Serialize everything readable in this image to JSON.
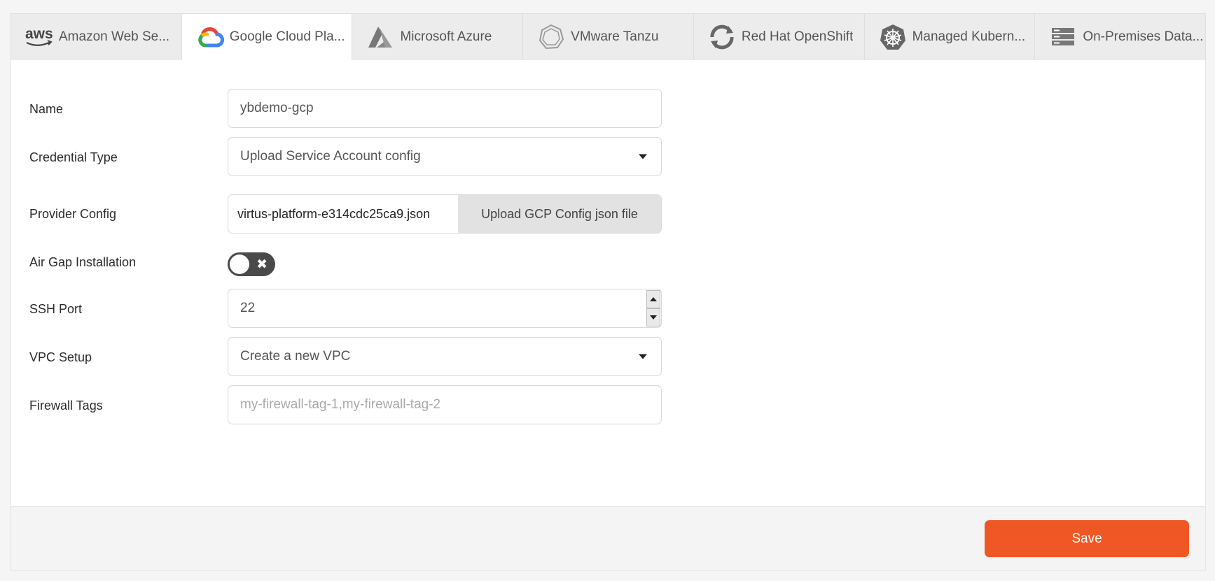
{
  "tabs": [
    {
      "label": "Amazon Web Se...",
      "icon": "aws-logo-icon",
      "active": false
    },
    {
      "label": "Google Cloud Pla...",
      "icon": "google-cloud-logo-icon",
      "active": true
    },
    {
      "label": "Microsoft Azure",
      "icon": "azure-logo-icon",
      "active": false
    },
    {
      "label": "VMware Tanzu",
      "icon": "vmware-tanzu-logo-icon",
      "active": false
    },
    {
      "label": "Red Hat OpenShift",
      "icon": "openshift-logo-icon",
      "active": false
    },
    {
      "label": "Managed Kubern...",
      "icon": "kubernetes-logo-icon",
      "active": false
    },
    {
      "label": "On-Premises Data...",
      "icon": "server-rack-icon",
      "active": false
    }
  ],
  "aws_text": "aws",
  "form": {
    "name": {
      "label": "Name",
      "value": "ybdemo-gcp"
    },
    "credential_type": {
      "label": "Credential Type",
      "value": "Upload Service Account config"
    },
    "provider_config": {
      "label": "Provider Config",
      "file_name": "virtus-platform-e314cdc25ca9.json",
      "button_label": "Upload GCP Config json file"
    },
    "air_gap": {
      "label": "Air Gap Installation",
      "enabled": false
    },
    "ssh_port": {
      "label": "SSH Port",
      "value": "22"
    },
    "vpc_setup": {
      "label": "VPC Setup",
      "value": "Create a new VPC"
    },
    "firewall_tags": {
      "label": "Firewall Tags",
      "placeholder": "my-firewall-tag-1,my-firewall-tag-2"
    }
  },
  "footer": {
    "save_label": "Save"
  },
  "colors": {
    "accent": "#ef5824",
    "toggle_off": "#4a4a4a"
  }
}
